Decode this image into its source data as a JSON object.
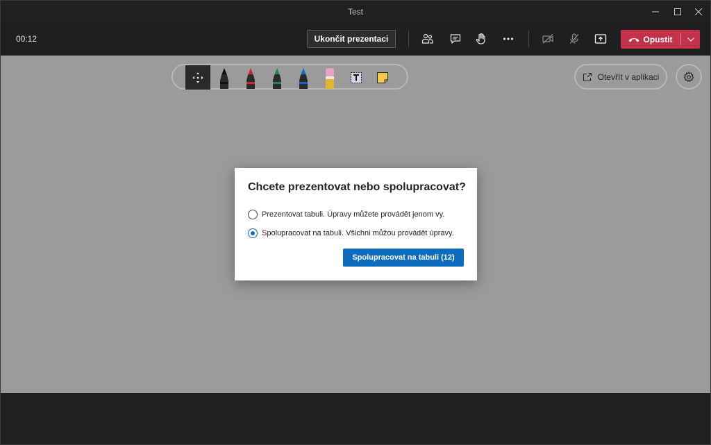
{
  "window": {
    "title": "Test"
  },
  "meeting": {
    "timer": "00:12",
    "stop_presenting_label": "Ukončit prezentaci",
    "leave_label": "Opustit",
    "colors": {
      "leave": "#c4314b",
      "accent": "#0f6cbd"
    }
  },
  "whiteboard": {
    "tools": [
      {
        "name": "move-tool",
        "icon": "move-arrows-icon",
        "selected": true
      },
      {
        "name": "black-pen",
        "icon": "pen-icon",
        "color": "#111111"
      },
      {
        "name": "red-pen",
        "icon": "pen-icon",
        "color": "#c8283c"
      },
      {
        "name": "green-pen",
        "icon": "pen-icon",
        "color": "#1a8a4a"
      },
      {
        "name": "blue-pen",
        "icon": "pen-icon",
        "color": "#1464c8"
      },
      {
        "name": "eraser",
        "icon": "eraser-icon",
        "color": "#e7a3c7"
      },
      {
        "name": "text-tool",
        "icon": "text-box-icon"
      },
      {
        "name": "sticky-note",
        "icon": "sticky-note-icon",
        "color": "#f2c94c"
      }
    ],
    "open_in_app_label": "Otevřít v aplikaci"
  },
  "dialog": {
    "title": "Chcete prezentovat nebo spolupracovat?",
    "options": [
      {
        "label": "Prezentovat tabuli. Úpravy můžete provádět jenom vy.",
        "checked": false
      },
      {
        "label": "Spolupracovat na tabuli. Všichni můžou provádět úpravy.",
        "checked": true
      }
    ],
    "primary_label": "Spolupracovat na tabuli (12)"
  }
}
